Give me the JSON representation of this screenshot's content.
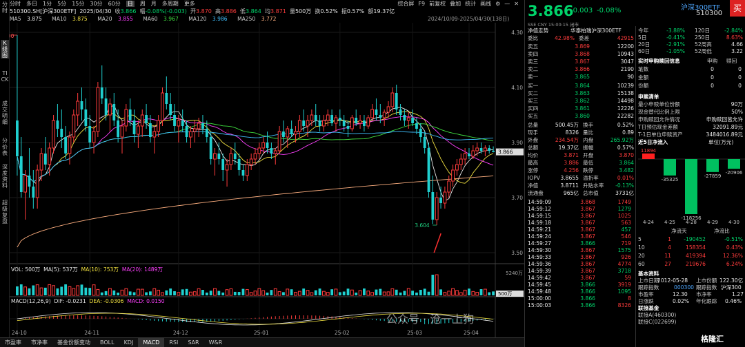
{
  "left_tabs": [
    "分时",
    "K线图",
    "TICK",
    "成交明细",
    "分价表",
    "深度资料",
    "超级复盘"
  ],
  "top_tabs": [
    "分时",
    "多日",
    "1分",
    "5分",
    "15分",
    "30分",
    "60分",
    "日",
    "周",
    "月",
    "多周期",
    "更多"
  ],
  "top_tabs_selected": "日",
  "top_right": [
    "综合屏",
    "F9",
    "前复权",
    "叠加",
    "统计",
    "画线",
    "⚙",
    "—",
    "✕"
  ],
  "info_line": {
    "code": "510300.SH[沪深300ETF]",
    "date": "2025/04/30",
    "close_l": "收",
    "close": "3.866",
    "chg_l": "幅",
    "chg": "-0.08%(-0.003)",
    "open_l": "开",
    "open": "3.870",
    "high_l": "高",
    "high": "3.886",
    "low_l": "低",
    "low": "3.864",
    "avg_l": "均",
    "avg": "3.871",
    "vol_l": "量",
    "vol": "500万",
    "turn_l": "换",
    "turn": "0.52%",
    "amp_l": "振",
    "amp": "0.57%",
    "amt_l": "额",
    "amt": "19.37亿"
  },
  "ma_line": [
    {
      "label": "MA5",
      "value": "3.875",
      "color": "#e8e8e8"
    },
    {
      "label": "MA10",
      "value": "3.875",
      "color": "#f0e040"
    },
    {
      "label": "MA20",
      "value": "3.855",
      "color": "#ff40ff"
    },
    {
      "label": "MA60",
      "value": "3.967",
      "color": "#40e040"
    },
    {
      "label": "MA120",
      "value": "3.986",
      "color": "#40c0ff"
    },
    {
      "label": "MA250",
      "value": "3.772",
      "color": "#ffb080"
    }
  ],
  "date_range": "2024/10/09-2025/04/30(138日)",
  "chart_data": {
    "type": "candlestick",
    "ylim": [
      3.48,
      4.32
    ],
    "y_ticks": [
      "4.30",
      "4.10",
      "3.90",
      "3.70",
      "3.50"
    ],
    "x_ticks": [
      "24-10",
      "24-11",
      "24-12",
      "25-01",
      "25-02",
      "25-03",
      "25-04"
    ],
    "annotations": {
      "high": "4.290",
      "low": "3.604",
      "last": "3.866"
    },
    "candles": [
      [
        3.98,
        4.29,
        3.78,
        3.85
      ],
      [
        3.85,
        3.92,
        3.7,
        3.72
      ],
      [
        3.72,
        3.8,
        3.62,
        3.78
      ],
      [
        3.78,
        3.88,
        3.7,
        3.74
      ],
      [
        3.74,
        3.8,
        3.66,
        3.7
      ],
      [
        3.7,
        3.82,
        3.66,
        3.8
      ],
      [
        3.8,
        3.88,
        3.76,
        3.86
      ],
      [
        3.86,
        3.92,
        3.8,
        3.82
      ],
      [
        3.82,
        3.9,
        3.78,
        3.88
      ],
      [
        3.88,
        4.0,
        3.86,
        3.98
      ],
      [
        3.98,
        4.04,
        3.92,
        3.95
      ],
      [
        3.95,
        4.02,
        3.88,
        3.92
      ],
      [
        3.92,
        3.96,
        3.84,
        3.86
      ],
      [
        3.86,
        3.94,
        3.82,
        3.92
      ],
      [
        3.92,
        4.02,
        3.9,
        4.0
      ],
      [
        4.0,
        4.08,
        3.96,
        4.05
      ],
      [
        4.05,
        4.1,
        3.98,
        4.02
      ],
      [
        4.02,
        4.06,
        3.94,
        3.96
      ],
      [
        3.96,
        4.0,
        3.88,
        3.9
      ],
      [
        3.9,
        3.96,
        3.86,
        3.94
      ],
      [
        3.94,
        4.12,
        3.92,
        4.1
      ],
      [
        4.1,
        4.18,
        4.04,
        4.06
      ],
      [
        4.06,
        4.1,
        3.98,
        4.0
      ],
      [
        4.0,
        4.06,
        3.94,
        4.04
      ],
      [
        4.04,
        4.08,
        3.96,
        3.98
      ],
      [
        3.98,
        4.02,
        3.9,
        3.92
      ],
      [
        3.92,
        3.98,
        3.86,
        3.96
      ],
      [
        3.96,
        4.04,
        3.94,
        4.02
      ],
      [
        4.02,
        4.06,
        3.96,
        3.98
      ],
      [
        3.98,
        4.02,
        3.9,
        3.93
      ],
      [
        3.93,
        3.98,
        3.88,
        3.96
      ],
      [
        3.96,
        4.02,
        3.92,
        4.0
      ],
      [
        4.0,
        4.04,
        3.95,
        3.97
      ],
      [
        3.97,
        4.0,
        3.9,
        3.92
      ],
      [
        3.92,
        3.96,
        3.86,
        3.94
      ],
      [
        3.94,
        4.0,
        3.92,
        3.98
      ],
      [
        3.98,
        4.1,
        3.96,
        4.08
      ],
      [
        4.08,
        4.14,
        4.02,
        4.04
      ],
      [
        4.04,
        4.08,
        3.98,
        4.0
      ],
      [
        4.0,
        4.04,
        3.94,
        3.96
      ],
      [
        3.96,
        4.0,
        3.9,
        3.98
      ],
      [
        3.98,
        4.02,
        3.94,
        3.96
      ],
      [
        3.96,
        3.98,
        3.9,
        3.92
      ],
      [
        3.92,
        3.96,
        3.88,
        3.94
      ],
      [
        3.94,
        3.98,
        3.9,
        3.95
      ],
      [
        3.95,
        3.99,
        3.92,
        3.97
      ],
      [
        3.97,
        4.0,
        3.93,
        3.95
      ],
      [
        3.95,
        3.98,
        3.9,
        3.92
      ],
      [
        3.92,
        3.94,
        3.82,
        3.84
      ],
      [
        3.84,
        3.88,
        3.78,
        3.86
      ],
      [
        3.86,
        3.9,
        3.82,
        3.84
      ],
      [
        3.84,
        3.86,
        3.76,
        3.8
      ],
      [
        3.8,
        3.84,
        3.74,
        3.82
      ],
      [
        3.82,
        3.88,
        3.8,
        3.86
      ],
      [
        3.86,
        3.9,
        3.82,
        3.84
      ],
      [
        3.84,
        3.86,
        3.78,
        3.8
      ],
      [
        3.8,
        3.82,
        3.76,
        3.78
      ],
      [
        3.78,
        3.84,
        3.76,
        3.82
      ],
      [
        3.82,
        3.86,
        3.8,
        3.84
      ],
      [
        3.84,
        3.88,
        3.82,
        3.86
      ],
      [
        3.86,
        3.9,
        3.84,
        3.88
      ],
      [
        3.88,
        3.92,
        3.86,
        3.9
      ],
      [
        3.9,
        3.94,
        3.86,
        3.88
      ],
      [
        3.88,
        3.9,
        3.84,
        3.86
      ],
      [
        3.86,
        3.88,
        3.82,
        3.87
      ],
      [
        3.87,
        3.96,
        3.86,
        3.94
      ],
      [
        3.94,
        3.98,
        3.9,
        3.92
      ],
      [
        3.92,
        3.96,
        3.88,
        3.95
      ],
      [
        3.95,
        3.98,
        3.92,
        3.93
      ],
      [
        3.93,
        3.96,
        3.9,
        3.94
      ],
      [
        3.94,
        4.0,
        3.92,
        3.98
      ],
      [
        3.98,
        4.02,
        3.94,
        3.96
      ],
      [
        3.96,
        4.0,
        3.92,
        3.98
      ],
      [
        3.98,
        4.02,
        3.96,
        4.0
      ],
      [
        4.0,
        4.04,
        3.96,
        3.98
      ],
      [
        3.98,
        4.0,
        3.94,
        3.96
      ],
      [
        3.96,
        4.0,
        3.94,
        3.98
      ],
      [
        3.98,
        4.02,
        3.96,
        4.0
      ],
      [
        4.0,
        4.02,
        3.96,
        3.97
      ],
      [
        3.97,
        4.0,
        3.94,
        3.99
      ],
      [
        3.99,
        4.02,
        3.96,
        3.98
      ],
      [
        3.98,
        4.0,
        3.94,
        3.96
      ],
      [
        3.96,
        3.98,
        3.92,
        3.95
      ],
      [
        3.95,
        4.0,
        3.94,
        3.99
      ],
      [
        3.99,
        4.02,
        3.96,
        3.97
      ],
      [
        3.97,
        4.0,
        3.95,
        3.98
      ],
      [
        3.98,
        4.0,
        3.94,
        3.96
      ],
      [
        3.96,
        4.0,
        3.95,
        3.99
      ],
      [
        3.99,
        4.04,
        3.98,
        4.02
      ],
      [
        4.02,
        4.06,
        3.98,
        4.0
      ],
      [
        4.0,
        4.04,
        3.97,
        3.99
      ],
      [
        3.99,
        4.02,
        3.96,
        4.01
      ],
      [
        4.01,
        4.05,
        3.99,
        4.03
      ],
      [
        4.03,
        4.1,
        4.01,
        4.08
      ],
      [
        4.08,
        4.11,
        4.0,
        4.02
      ],
      [
        4.02,
        4.04,
        3.98,
        4.0
      ],
      [
        4.0,
        4.02,
        3.96,
        3.98
      ],
      [
        3.98,
        4.01,
        3.95,
        3.99
      ],
      [
        3.99,
        4.02,
        3.96,
        3.97
      ],
      [
        3.97,
        3.99,
        3.93,
        3.95
      ],
      [
        3.95,
        3.97,
        3.9,
        3.92
      ],
      [
        3.92,
        3.94,
        3.86,
        3.88
      ],
      [
        3.88,
        3.9,
        3.7,
        3.72
      ],
      [
        3.72,
        3.78,
        3.604,
        3.62
      ],
      [
        3.62,
        3.72,
        3.6,
        3.7
      ],
      [
        3.7,
        3.74,
        3.66,
        3.68
      ],
      [
        3.68,
        3.74,
        3.66,
        3.72
      ],
      [
        3.72,
        3.78,
        3.7,
        3.76
      ],
      [
        3.76,
        3.82,
        3.74,
        3.8
      ],
      [
        3.8,
        3.84,
        3.78,
        3.82
      ],
      [
        3.82,
        3.86,
        3.8,
        3.84
      ],
      [
        3.84,
        3.88,
        3.82,
        3.86
      ],
      [
        3.86,
        3.88,
        3.84,
        3.85
      ],
      [
        3.85,
        3.89,
        3.84,
        3.87
      ],
      [
        3.87,
        3.9,
        3.85,
        3.88
      ],
      [
        3.88,
        3.9,
        3.86,
        3.87
      ],
      [
        3.87,
        3.89,
        3.85,
        3.88
      ],
      [
        3.88,
        3.89,
        3.86,
        3.87
      ],
      [
        3.87,
        3.886,
        3.864,
        3.866
      ]
    ],
    "series": [
      {
        "name": "MA5",
        "color": "#e8e8e8"
      },
      {
        "name": "MA10",
        "color": "#f0e040"
      },
      {
        "name": "MA20",
        "color": "#ff40ff"
      },
      {
        "name": "MA60",
        "color": "#40e040"
      },
      {
        "name": "MA120",
        "color": "#40c0ff"
      },
      {
        "name": "MA250",
        "color": "#ffb080"
      }
    ]
  },
  "vol_line": {
    "label": "VOL: 500万",
    "ma5": "MA(5): 537万",
    "ma10": "MA(10): 753万",
    "ma20": "MA(20): 1489万",
    "top": "5240万",
    "last": "500万"
  },
  "macd_line": {
    "label": "MACD(12,26,9)",
    "dif": "DIF: -0.0231",
    "dea": "DEA: -0.0306",
    "macd": "MACD: 0.0150"
  },
  "bottom_tabs": [
    "市盈率",
    "市净率",
    "基金份额变动",
    "BOLL",
    "KDJ",
    "MACD",
    "RSI",
    "SAR",
    "W&R"
  ],
  "bottom_selected": "MACD",
  "quote": {
    "price": "3.866",
    "chg": "-0.003",
    "pct": "-0.08%",
    "name": "沪深300ETF",
    "code": "510300",
    "buy": "买",
    "sub": "SSE  CNY  15:00:15  闭市"
  },
  "fund": {
    "l1": "净值走势",
    "n1": "华泰柏瑞沪深300ETF",
    "l2": "委比",
    "v2": "42.98%",
    "l2b": "委差",
    "v2b": "42915"
  },
  "asks": [
    {
      "l": "卖五",
      "p": "3.869",
      "v": "12200"
    },
    {
      "l": "卖四",
      "p": "3.868",
      "v": "10943"
    },
    {
      "l": "卖三",
      "p": "3.867",
      "v": "3047"
    },
    {
      "l": "卖二",
      "p": "3.866",
      "v": "2190"
    },
    {
      "l": "卖一",
      "p": "3.865",
      "v": "90"
    }
  ],
  "bids": [
    {
      "l": "买一",
      "p": "3.864",
      "v": "10239"
    },
    {
      "l": "买二",
      "p": "3.863",
      "v": "15138"
    },
    {
      "l": "买三",
      "p": "3.862",
      "v": "14498"
    },
    {
      "l": "买四",
      "p": "3.861",
      "v": "12226"
    },
    {
      "l": "买五",
      "p": "3.860",
      "v": "22282"
    }
  ],
  "stats": [
    [
      "总量",
      "500.45万",
      "换手",
      "0.52%"
    ],
    [
      "现手",
      "8326",
      "量比",
      "0.89"
    ],
    [
      "外盘",
      "234.54万",
      "内盘",
      "265.92万"
    ],
    [
      "总额",
      "19.37亿",
      "振幅",
      "0.57%"
    ],
    [
      "均价",
      "3.871",
      "开盘",
      "3.870"
    ],
    [
      "最高",
      "3.886",
      "最低",
      "3.864"
    ],
    [
      "涨停",
      "4.256",
      "跌停",
      "3.482"
    ],
    [
      "IOPV",
      "3.8655",
      "溢折率",
      "0.01%"
    ],
    [
      "净值",
      "3.8711",
      "升贴水率",
      "-0.13%"
    ],
    [
      "流通盘",
      "965亿",
      "总市值",
      "3731亿"
    ]
  ],
  "ticks": [
    [
      "14:59:09",
      "3.868",
      "1749"
    ],
    [
      "14:59:12",
      "3.867",
      "1279"
    ],
    [
      "14:59:15",
      "3.867",
      "1025"
    ],
    [
      "14:59:18",
      "3.867",
      "563"
    ],
    [
      "14:59:21",
      "3.867",
      "457"
    ],
    [
      "14:59:24",
      "3.867",
      "546"
    ],
    [
      "14:59:27",
      "3.866",
      "719"
    ],
    [
      "14:59:30",
      "3.867",
      "1575"
    ],
    [
      "14:59:33",
      "3.867",
      "926"
    ],
    [
      "14:59:36",
      "3.867",
      "4774"
    ],
    [
      "14:59:39",
      "3.867",
      "3718"
    ],
    [
      "14:59:42",
      "3.867",
      "59"
    ],
    [
      "14:59:45",
      "3.866",
      "3919"
    ],
    [
      "14:59:48",
      "3.866",
      "1095"
    ],
    [
      "15:00:00",
      "3.866",
      "8"
    ],
    [
      "15:00:03",
      "3.866",
      "8326"
    ]
  ],
  "period": [
    [
      "今年",
      "-3.88%",
      "120日",
      "-2.84%"
    ],
    [
      "5日",
      "-0.41%",
      "250日",
      "8.63%"
    ],
    [
      "20日",
      "-2.91%",
      "52周高",
      "4.66"
    ],
    [
      "60日",
      "-1.05%",
      "52周低",
      "3.22"
    ]
  ],
  "sub_redeem": {
    "title": "实时申购赎回信息",
    "h1": "申购",
    "h2": "赎回",
    "rows": [
      [
        "笔数",
        "0",
        "0"
      ],
      [
        "金额",
        "0",
        "0"
      ],
      [
        "份额",
        "0",
        "0"
      ]
    ]
  },
  "sub_list": {
    "title": "申赎清单",
    "rows": [
      [
        "最小申赎单位份额",
        "90万"
      ],
      [
        "现金替代比例上限",
        "50%"
      ],
      [
        "申购赎回允许情况",
        "申购赎回皆允许"
      ],
      [
        "T日预估现金差额",
        "32091.89元"
      ],
      [
        "T-1日单位申赎资产",
        "3484016.89元"
      ]
    ]
  },
  "flow": {
    "title": "近5日净流入",
    "unit": "单位(万元)",
    "dates": [
      "4-24",
      "4-25",
      "4-28",
      "4-29",
      "4-30"
    ],
    "values": [
      11894,
      -35325,
      -118256,
      -27859,
      -20906
    ],
    "labels": [
      "11894",
      "-35325",
      "-118256",
      "-27859",
      "-20906"
    ]
  },
  "flow_table": {
    "h1": "净流天",
    "h2": "净流比",
    "rows": [
      [
        "5",
        "1",
        "-190452",
        "-0.51%"
      ],
      [
        "10",
        "4",
        "158354",
        "0.43%"
      ],
      [
        "20",
        "11",
        "419394",
        "12.36%"
      ],
      [
        "60",
        "27",
        "219676",
        "6.24%"
      ]
    ]
  },
  "basic": {
    "title": "基本资料",
    "r1": [
      "上市日期",
      "2012-05-28",
      "上市份额",
      "122.30亿"
    ],
    "r2": [
      "跟踪指数",
      "000300",
      "跟踪指数",
      "沪深300"
    ],
    "r3": [
      "市盈率",
      "12.30",
      "市净率",
      "1.27"
    ],
    "r4": [
      "日涨跌",
      "0.02%",
      "年化跟踪",
      "0.46%"
    ],
    "r5": "联接基金",
    "r6": [
      "联接A(460300)",
      "联接C(022699)"
    ]
  },
  "watermark": "公众号 · 沧一上狗",
  "brand": "格隆汇"
}
